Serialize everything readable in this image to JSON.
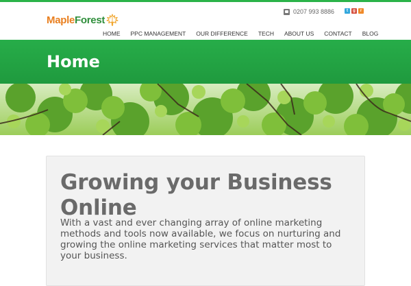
{
  "brand": {
    "name_part1": "Maple",
    "name_part2": "Forest",
    "colors": {
      "orange": "#e97f1f",
      "green": "#2f8e3b",
      "accent": "#2bb34a"
    }
  },
  "contact": {
    "phone_icon": "phone-icon",
    "phone": "0207 993 8886"
  },
  "social": [
    {
      "name": "twitter-icon",
      "glyph": "t"
    },
    {
      "name": "google-plus-icon",
      "glyph": "g"
    },
    {
      "name": "rss-icon",
      "glyph": "r"
    }
  ],
  "nav": {
    "items": [
      {
        "label": "HOME",
        "active": true
      },
      {
        "label": "PPC MANAGEMENT",
        "active": false
      },
      {
        "label": "OUR DIFFERENCE",
        "active": false
      },
      {
        "label": "TECH",
        "active": false
      },
      {
        "label": "ABOUT US",
        "active": false
      },
      {
        "label": "CONTACT",
        "active": false
      },
      {
        "label": "BLOG",
        "active": false
      }
    ]
  },
  "hero": {
    "title": "Home"
  },
  "content": {
    "heading": "Growing your Business Online",
    "body": "With a vast and ever changing array of online marketing methods and tools now available, we focus on nurturing and growing the online marketing services that matter most to your business."
  }
}
